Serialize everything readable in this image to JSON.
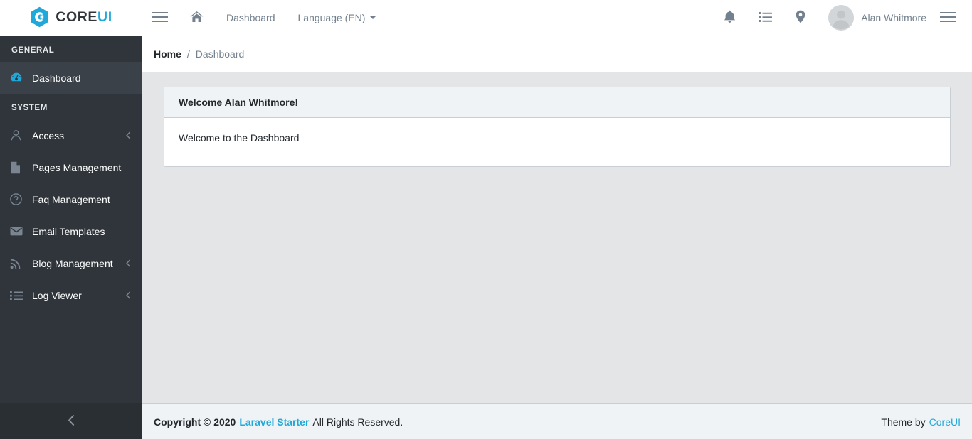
{
  "brand": {
    "icon": "coreui-hexagon-logo-icon",
    "text_primary": "CORE",
    "text_accent": "UI",
    "accent_color": "#20a8d8"
  },
  "header": {
    "sidebar_toggler_icon": "hamburger-icon",
    "home_icon": "home-icon",
    "nav_items": [
      {
        "label": "Dashboard",
        "icon": "",
        "has_caret": false
      },
      {
        "label": "Language (EN)",
        "icon": "caret-down-icon",
        "has_caret": true
      }
    ],
    "actions": [
      {
        "name": "notifications",
        "icon": "bell-icon"
      },
      {
        "name": "tasks",
        "icon": "list-icon"
      },
      {
        "name": "location",
        "icon": "map-pin-icon"
      }
    ],
    "user": {
      "name": "Alan Whitmore",
      "avatar_icon": "user-avatar-placeholder-icon"
    },
    "aside_toggler_icon": "hamburger-icon"
  },
  "sidebar": {
    "background_color": "#2f353a",
    "active_color": "#20a8d8",
    "groups": [
      {
        "title": "GENERAL",
        "items": [
          {
            "label": "Dashboard",
            "icon": "speedometer-icon",
            "active": true,
            "has_submenu": false
          }
        ]
      },
      {
        "title": "SYSTEM",
        "items": [
          {
            "label": "Access",
            "icon": "user-icon",
            "active": false,
            "has_submenu": true
          },
          {
            "label": "Pages Management",
            "icon": "file-icon",
            "active": false,
            "has_submenu": false
          },
          {
            "label": "Faq Management",
            "icon": "question-circle-icon",
            "active": false,
            "has_submenu": false
          },
          {
            "label": "Email Templates",
            "icon": "envelope-icon",
            "active": false,
            "has_submenu": false
          },
          {
            "label": "Blog Management",
            "icon": "rss-icon",
            "active": false,
            "has_submenu": true
          },
          {
            "label": "Log Viewer",
            "icon": "list-icon",
            "active": false,
            "has_submenu": true
          }
        ]
      }
    ],
    "minimizer_icon": "chevron-left-icon",
    "submenu_icon": "chevron-left-icon"
  },
  "breadcrumb": {
    "home_label": "Home",
    "separator": "/",
    "current_label": "Dashboard"
  },
  "main": {
    "card": {
      "header_title": "Welcome Alan Whitmore!",
      "body_text": "Welcome to the Dashboard"
    }
  },
  "footer": {
    "copyright_prefix": "Copyright © 2020",
    "app_link": "Laravel Starter",
    "copyright_suffix": "All Rights Reserved.",
    "theme_prefix": "Theme by",
    "theme_link": "CoreUI"
  }
}
